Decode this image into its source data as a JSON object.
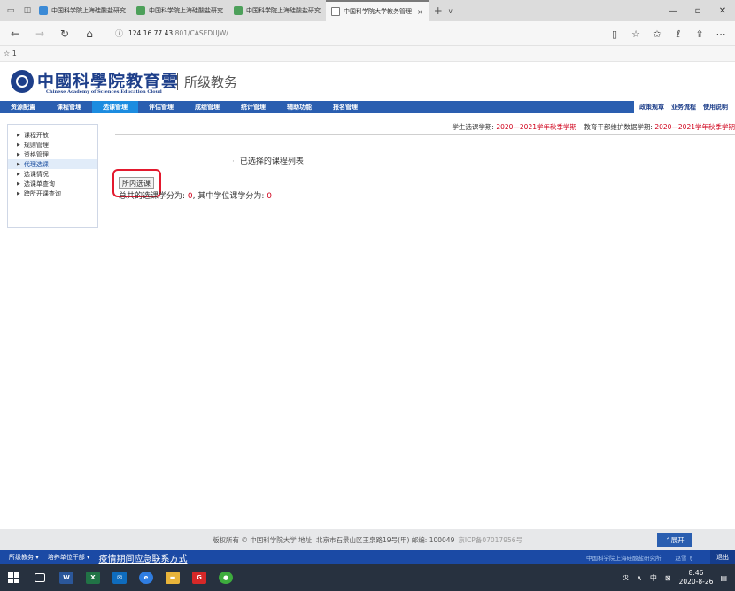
{
  "browser": {
    "tabs": [
      {
        "label": "中国科学院上海硅酸盐研究",
        "icon": "cas-favicon"
      },
      {
        "label": "中国科学院上海硅酸盐研究",
        "icon": "green-favicon"
      },
      {
        "label": "中国科学院上海硅酸盐研究",
        "icon": "green-favicon"
      },
      {
        "label": "中国科学院大学教务管理",
        "icon": "page-favicon"
      }
    ],
    "close_symbol": "×",
    "add_symbol": "+",
    "dropdown_symbol": "∨",
    "url_host": "124.16.77.43",
    "url_path": ":801/CASEDUJW/",
    "favorites": "☆ 1"
  },
  "site": {
    "logo_cn": "中國科學院教育雲",
    "logo_en": "Chinese Academy of Sciences Education Cloud",
    "subtitle": "所级教务"
  },
  "menu": {
    "items": [
      {
        "label": "资源配置"
      },
      {
        "label": "课程管理"
      },
      {
        "label": "选课管理"
      },
      {
        "label": "评估管理"
      },
      {
        "label": "成绩管理"
      },
      {
        "label": "统计管理"
      },
      {
        "label": "辅助功能"
      },
      {
        "label": "报名管理"
      }
    ],
    "right": [
      "政策规章",
      "业务流程",
      "使用说明"
    ]
  },
  "sidebar": {
    "items": [
      {
        "label": "课程开放"
      },
      {
        "label": "规则管理"
      },
      {
        "label": "资格管理"
      },
      {
        "label": "代理选课"
      },
      {
        "label": "选课情况"
      },
      {
        "label": "选课单查询"
      },
      {
        "label": "跨所开课查询"
      }
    ]
  },
  "term": {
    "student_label": "学生选课学期:",
    "student_value": "2020—2021学年秋季学期",
    "staff_label": "教育干部维护数据学期:",
    "staff_value": "2020—2021学年秋季学期"
  },
  "main": {
    "list_title": "已选择的课程列表",
    "local_button": "所内选课",
    "credits_prefix": "总共的选课学分为:",
    "credits_total": "0",
    "credits_mid": ", 其中学位课学分为:",
    "credits_degree": "0"
  },
  "footer": {
    "copyright": "版权所有 © 中国科学院大学 地址: 北京市石景山区玉泉路19号(甲) 邮编: 100049",
    "icp": "京ICP备07017956号",
    "expand": "⌃展开"
  },
  "statusbar": {
    "system": "所级教务 ▾",
    "unit": "培养单位干部 ▾",
    "link": "疫情期间应急联系方式",
    "institute": "中国科学院上海硅酸盐研究所",
    "user": "赵雪飞",
    "logout": "退出"
  },
  "taskbar": {
    "ime": "中",
    "time": "8:46",
    "date": "2020-8-26"
  }
}
